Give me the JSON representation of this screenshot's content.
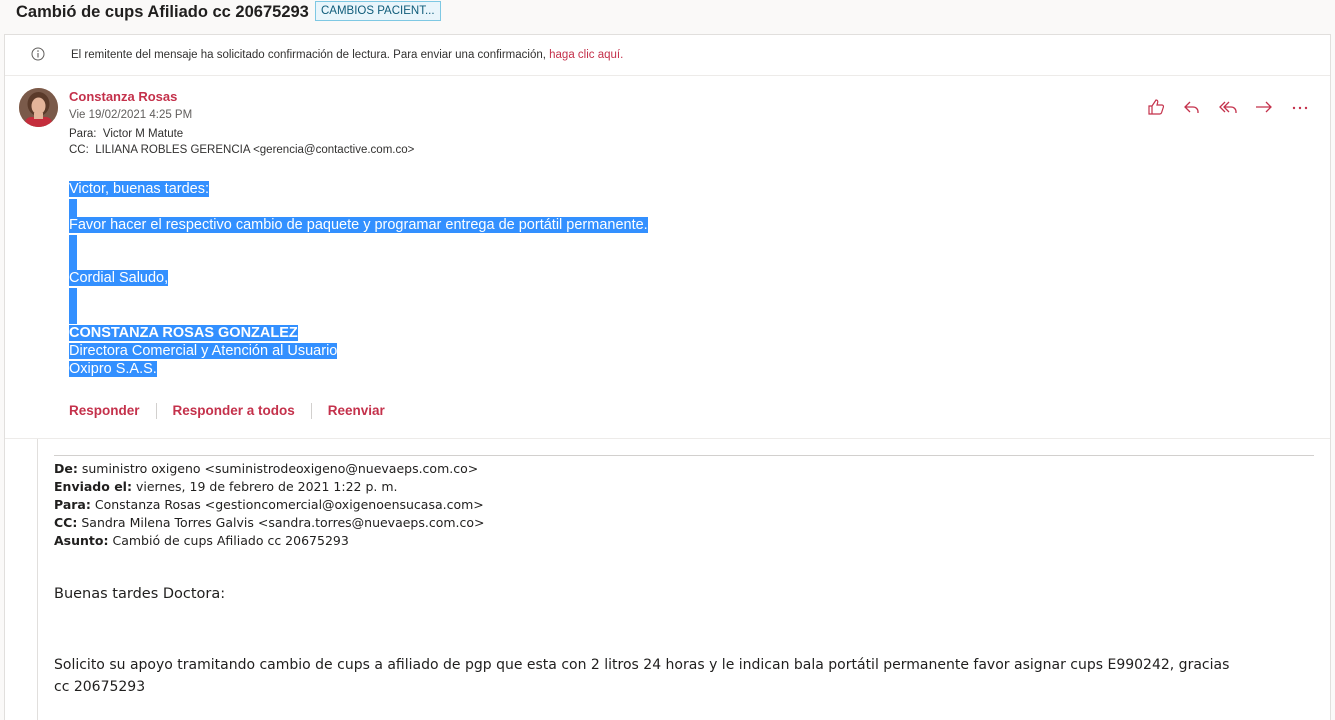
{
  "subject": {
    "title": "Cambió de cups Afiliado cc 20675293",
    "category": "CAMBIOS PACIENT..."
  },
  "read_receipt": {
    "text": "El remitente del mensaje ha solicitado confirmación de lectura. Para enviar una confirmación, ",
    "link": "haga clic aquí."
  },
  "message": {
    "sender": "Constanza Rosas",
    "date": "Vie 19/02/2021 4:25 PM",
    "to_label": "Para:",
    "to": "Victor M Matute",
    "cc_label": "CC:",
    "cc": "LILIANA ROBLES GERENCIA <gerencia@contactive.com.co>",
    "body": {
      "greeting": "Victor, buenas tardes:",
      "line1": "Favor hacer el respectivo cambio de paquete y programar entrega de portátil permanente.",
      "closing": "Cordial Saludo,",
      "sig_name": "CONSTANZA ROSAS GONZALEZ",
      "sig_title": "Directora Comercial y Atención al Usuario",
      "sig_company": "Oxipro S.A.S."
    },
    "reply_actions": {
      "reply": "Responder",
      "reply_all": "Responder a todos",
      "forward": "Reenviar"
    },
    "toolbar_icons": [
      "like-icon",
      "reply-icon",
      "reply-all-icon",
      "forward-icon",
      "more-icon"
    ]
  },
  "quoted": {
    "from_label": "De:",
    "from": "suministro oxigeno <suministrodeoxigeno@nuevaeps.com.co>",
    "sent_label": "Enviado el:",
    "sent": "viernes, 19 de febrero de 2021 1:22 p. m.",
    "to_label": "Para:",
    "to": "Constanza Rosas <gestioncomercial@oxigenoensucasa.com>",
    "cc_label": "CC:",
    "cc": "Sandra Milena Torres Galvis <sandra.torres@nuevaeps.com.co>",
    "subject_label": "Asunto:",
    "subject": "Cambió de cups Afiliado cc 20675293",
    "greeting": "Buenas tardes Doctora:",
    "paragraph_line1": "Solicito su apoyo tramitando cambio de cups a afiliado de pgp que esta con 2 litros 24 horas y le indican bala portátil permanente favor asignar cups E990242, gracias",
    "paragraph_line2": "cc 20675293"
  },
  "colors": {
    "accent": "#c4314b",
    "selection": "#3390ff",
    "tag_bg": "#e9f5fb"
  }
}
